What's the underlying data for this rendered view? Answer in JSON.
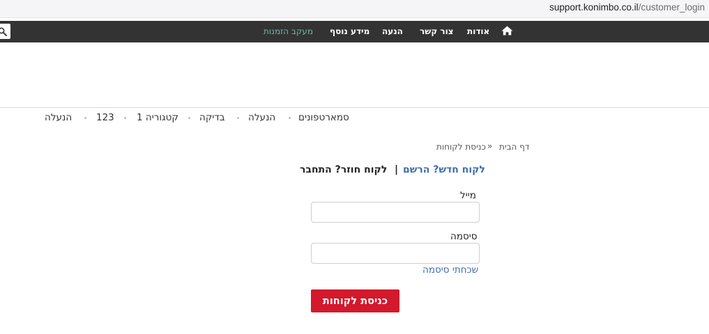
{
  "browser": {
    "url_host": "support.konimbo.co.il",
    "url_path": "/customer_login"
  },
  "topnav": {
    "home_icon": "home-icon",
    "search_icon": "search-icon",
    "items": [
      "אודות",
      "צור קשר",
      "הנעה",
      "מידע נוסף",
      "מעקב הזמנות"
    ],
    "accent_color": "#6fb9a9"
  },
  "categories": [
    "סמארטפונים",
    "הנעלה",
    "בדיקה",
    "קטגוריה 1",
    "123",
    "הנעלה"
  ],
  "breadcrumb": {
    "home": "דף הבית",
    "current": "כניסת לקוחות"
  },
  "login": {
    "returning": "לקוח חוזר? התחבר",
    "separator": "|",
    "new_customer": "לקוח חדש? הרשם",
    "email_label": "מייל",
    "password_label": "סיסמה",
    "forgot": "שכחתי סיסמה",
    "submit": "כניסת לקוחות",
    "submit_color": "#d3192c",
    "link_color": "#3d6cb0"
  }
}
